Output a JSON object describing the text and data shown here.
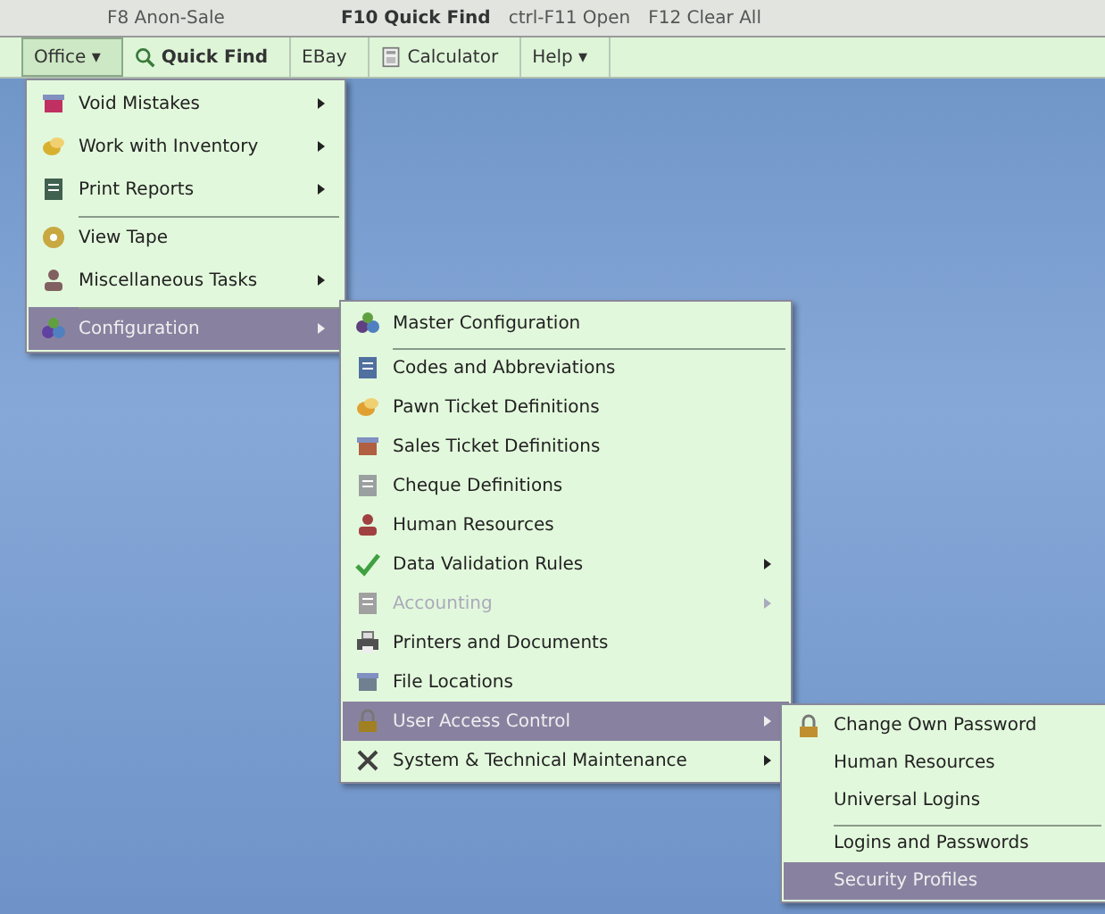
{
  "shortcut_bar": [
    "F8 Anon-Sale",
    "F10 Quick Find",
    "ctrl-F11 Open",
    "F12 Clear All"
  ],
  "toolbar": [
    {
      "label": "Office ▾",
      "selected": true
    },
    {
      "label": "Quick Find",
      "selected": false
    },
    {
      "label": "EBay",
      "selected": false
    },
    {
      "label": "Calculator",
      "selected": false
    },
    {
      "label": "Help ▾",
      "selected": false
    }
  ],
  "menus": [
    {
      "items": [
        {
          "label": "Void Mistakes",
          "submenu": true,
          "selected": false,
          "disabled": false,
          "separator_before": false
        },
        {
          "label": "Work with Inventory",
          "submenu": true,
          "selected": false,
          "disabled": false,
          "separator_before": false
        },
        {
          "label": "Print Reports",
          "submenu": true,
          "selected": false,
          "disabled": false,
          "separator_before": false
        },
        {
          "label": "View Tape",
          "submenu": false,
          "selected": false,
          "disabled": false,
          "separator_before": true
        },
        {
          "label": "Miscellaneous Tasks",
          "submenu": true,
          "selected": false,
          "disabled": false,
          "separator_before": false
        },
        {
          "label": "Configuration",
          "submenu": true,
          "selected": true,
          "disabled": false,
          "separator_before": true
        }
      ]
    },
    {
      "items": [
        {
          "label": "Master Configuration",
          "submenu": false,
          "selected": false,
          "disabled": false,
          "separator_before": false
        },
        {
          "label": "Codes and Abbreviations",
          "submenu": false,
          "selected": false,
          "disabled": false,
          "separator_before": true
        },
        {
          "label": "Pawn Ticket Definitions",
          "submenu": false,
          "selected": false,
          "disabled": false,
          "separator_before": false
        },
        {
          "label": "Sales Ticket Definitions",
          "submenu": false,
          "selected": false,
          "disabled": false,
          "separator_before": false
        },
        {
          "label": "Cheque Definitions",
          "submenu": false,
          "selected": false,
          "disabled": false,
          "separator_before": false
        },
        {
          "label": "Human Resources",
          "submenu": false,
          "selected": false,
          "disabled": false,
          "separator_before": false
        },
        {
          "label": "Data Validation Rules",
          "submenu": true,
          "selected": false,
          "disabled": false,
          "separator_before": false
        },
        {
          "label": "Accounting",
          "submenu": true,
          "selected": false,
          "disabled": true,
          "separator_before": false
        },
        {
          "label": "Printers and Documents",
          "submenu": false,
          "selected": false,
          "disabled": false,
          "separator_before": false
        },
        {
          "label": "File Locations",
          "submenu": false,
          "selected": false,
          "disabled": false,
          "separator_before": false
        },
        {
          "label": "User Access Control",
          "submenu": true,
          "selected": true,
          "disabled": false,
          "separator_before": false
        },
        {
          "label": "System & Technical Maintenance",
          "submenu": true,
          "selected": false,
          "disabled": false,
          "separator_before": false
        }
      ]
    },
    {
      "items": [
        {
          "label": "Change Own Password",
          "submenu": false,
          "selected": false,
          "disabled": false,
          "separator_before": false
        },
        {
          "label": "Human Resources",
          "submenu": false,
          "selected": false,
          "disabled": false,
          "separator_before": false
        },
        {
          "label": "Universal Logins",
          "submenu": false,
          "selected": false,
          "disabled": false,
          "separator_before": false
        },
        {
          "label": "Logins and Passwords",
          "submenu": false,
          "selected": false,
          "disabled": false,
          "separator_before": true
        },
        {
          "label": "Security Profiles",
          "submenu": false,
          "selected": true,
          "disabled": false,
          "separator_before": false
        }
      ]
    }
  ]
}
